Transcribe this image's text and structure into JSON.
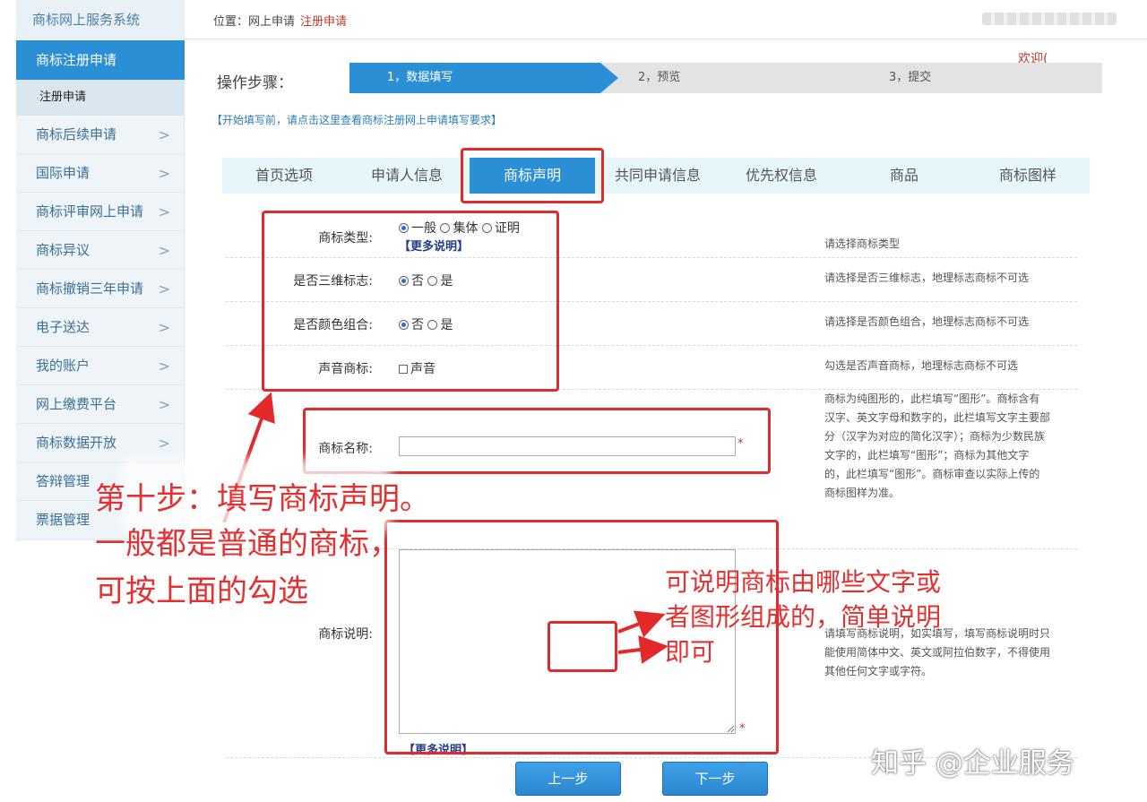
{
  "sidebar": {
    "system_title": "商标网上服务系统",
    "active_item": "商标注册申请",
    "sub_item": "注册申请",
    "items": [
      {
        "label": "商标后续申请"
      },
      {
        "label": "国际申请"
      },
      {
        "label": "商标评审网上申请"
      },
      {
        "label": "商标异议"
      },
      {
        "label": "商标撤销三年申请"
      },
      {
        "label": "电子送达"
      },
      {
        "label": "我的账户"
      },
      {
        "label": "网上缴费平台"
      },
      {
        "label": "商标数据开放"
      },
      {
        "label": "答辩管理"
      },
      {
        "label": "票据管理"
      }
    ],
    "chevron": ">"
  },
  "topbar": {
    "location_prefix": "位置：网上申请",
    "location_current": "注册申请",
    "welcome": "欢迎("
  },
  "steps": {
    "label": "操作步骤：",
    "items": [
      "1，数据填写",
      "2，预览",
      "3，提交"
    ]
  },
  "tip_link": "【开始填写前，请点击这里查看商标注册网上申请填写要求】",
  "tabs": [
    "首页选项",
    "申请人信息",
    "商标声明",
    "共同申请信息",
    "优先权信息",
    "商品",
    "商标图样"
  ],
  "form": {
    "type": {
      "label": "商标类型:",
      "options": [
        "一般",
        "集体",
        "证明"
      ],
      "selected": "一般",
      "more": "【更多说明】",
      "hint": "请选择商标类型"
    },
    "three_d": {
      "label": "是否三维标志:",
      "options": [
        "否",
        "是"
      ],
      "selected": "否",
      "hint": "请选择是否三维标志，地理标志商标不可选"
    },
    "color": {
      "label": "是否颜色组合:",
      "options": [
        "否",
        "是"
      ],
      "selected": "否",
      "hint": "请选择是否颜色组合，地理标志商标不可选"
    },
    "sound": {
      "label": "声音商标:",
      "option": "声音",
      "hint": "勾选是否声音商标，地理标志商标不可选"
    },
    "name": {
      "label": "商标名称:",
      "value": "",
      "required": "*",
      "hint_lines": [
        "商标为纯图形的，此栏填写“图形”。商标含有",
        "汉字、英文字母和数字的，此栏填写文字主要部",
        "分（汉字为对应的简化汉字）；商标为少数民族",
        "文字的，此栏填写“图形”；商标为其他文字",
        "的，此栏填写“图形”。商标审查以实际上传的",
        "商标图样为准。"
      ]
    },
    "description": {
      "label": "商标说明:",
      "value": "",
      "required": "*",
      "more": "【更多说明】",
      "hint_lines": [
        "请填写商标说明，如实填写，填写商标说明时只",
        "能使用简体中文、英文或阿拉伯数字，不得使用",
        "其他任何文字或字符。"
      ]
    }
  },
  "buttons": {
    "prev": "上一步",
    "next": "下一步"
  },
  "annotations": {
    "main_lines": [
      "第十步：填写商标声明。",
      "一般都是普通的商标，",
      "可按上面的勾选"
    ],
    "side_lines": [
      "可说明商标由哪些文字或",
      "者图形组成的，简单说明",
      "即可"
    ]
  },
  "watermark": "知乎 @企业服务",
  "colors": {
    "accent": "#2b8fd6",
    "annotation_red": "#e22a2a"
  }
}
